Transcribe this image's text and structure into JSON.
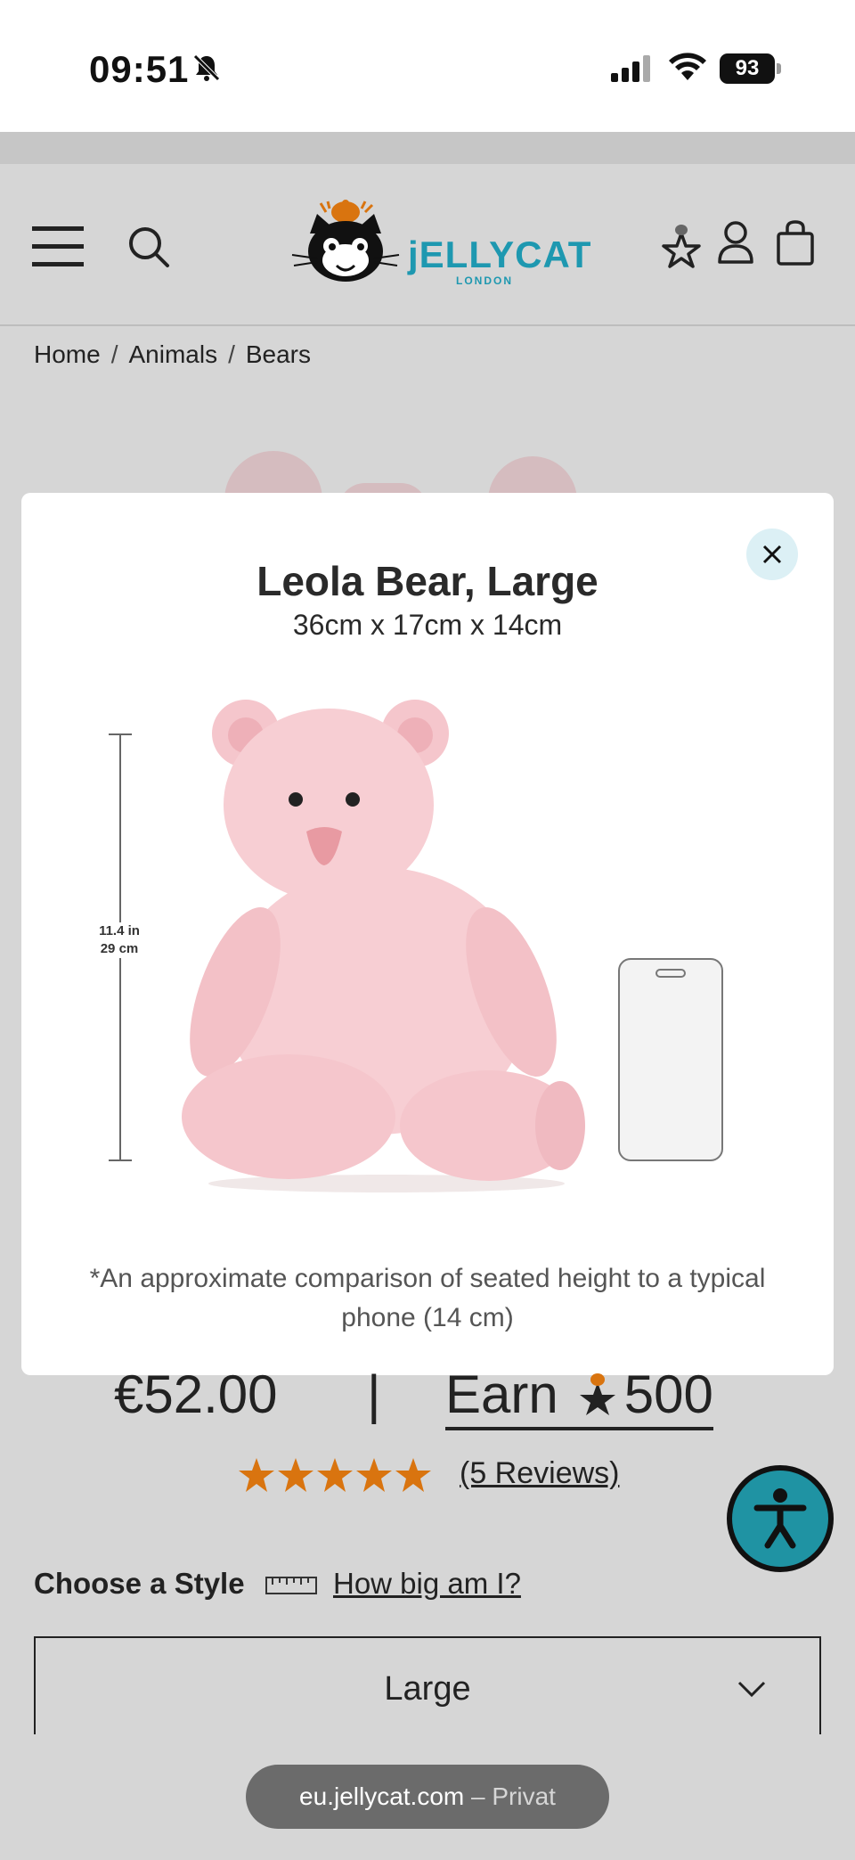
{
  "status_bar": {
    "time": "09:51",
    "battery": "93"
  },
  "breadcrumb": [
    "Home",
    "Animals",
    "Bears"
  ],
  "logo": {
    "brand": "jELLYCAT",
    "sub": "LONDON"
  },
  "modal": {
    "title": "Leola Bear, Large",
    "dimensions": "36cm x 17cm x 14cm",
    "height_in": "11.4 in",
    "height_cm": "29 cm",
    "note": "*An approximate comparison of seated height to a typical phone (14 cm)"
  },
  "product": {
    "price": "€52.00",
    "separator": "|",
    "earn_label": "Earn",
    "earn_points": "500",
    "rating": 5,
    "reviews": "(5 Reviews)",
    "style_label": "Choose a Style",
    "size_link": "How big am I?",
    "selected_style": "Large"
  },
  "browser": {
    "domain": "eu.jellycat.com",
    "mode": "– Privat"
  },
  "colors": {
    "brand_teal": "#1e98b0",
    "star_orange": "#d9740f",
    "close_bg": "#dcf0f5",
    "accessibility_bg": "#1f93a3"
  },
  "icons": [
    "bell-slash-icon",
    "signal-icon",
    "wifi-icon",
    "battery-icon",
    "menu-icon",
    "search-icon",
    "rewards-star-icon",
    "account-icon",
    "bag-icon",
    "close-icon",
    "ruler-icon",
    "chevron-down-icon",
    "accessibility-icon"
  ]
}
